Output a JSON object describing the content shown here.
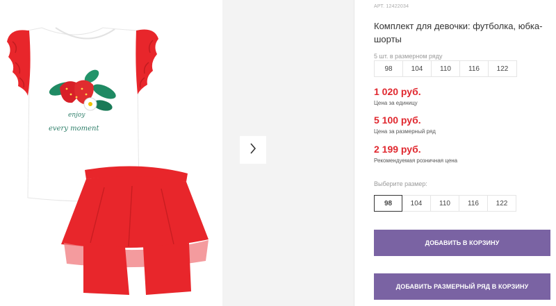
{
  "product": {
    "sku": "АРТ. 12422034",
    "title": "Комплект для девочки: футболка, юбка-шорты",
    "image": {
      "print_text_line1": "enjoy",
      "print_text_line2": "every moment"
    }
  },
  "pack": {
    "caption": "5 шт. в размерном ряду",
    "sizes": [
      "98",
      "104",
      "110",
      "116",
      "122"
    ]
  },
  "prices": {
    "unit_price": "1 020 руб.",
    "unit_label": "Цена за единицу",
    "pack_price": "5 100 руб.",
    "pack_label": "Цена за размерный ряд",
    "retail_price": "2 199 руб.",
    "retail_label": "Рекомендуемая розничная цена"
  },
  "size_picker": {
    "caption": "Выберите размер:",
    "options": [
      "98",
      "104",
      "110",
      "116",
      "122"
    ],
    "selected": "98"
  },
  "actions": {
    "add_to_cart": "ДОБАВИТЬ В КОРЗИНУ",
    "add_pack_to_cart": "ДОБАВИТЬ РАЗМЕРНЫЙ РЯД В КОРЗИНУ"
  },
  "colors": {
    "price_red": "#e0282f",
    "button_purple": "#7a63a3",
    "garment_red": "#e8262b"
  },
  "icons": {
    "gallery_next": "chevron-right-icon"
  }
}
